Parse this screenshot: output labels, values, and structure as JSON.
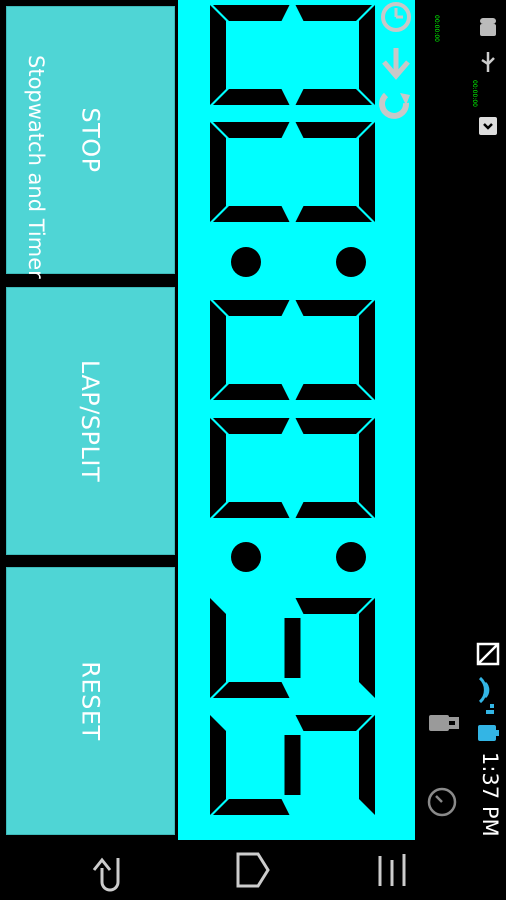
{
  "app": {
    "title": "Stopwatch and Timer"
  },
  "buttons": {
    "stop": "STOP",
    "lap": "LAP/SPLIT",
    "reset": "RESET"
  },
  "display": {
    "time": "00:00:55",
    "digits": [
      "0",
      "0",
      "0",
      "0",
      "5",
      "5"
    ]
  },
  "status_bar": {
    "time": "1:37 PM",
    "mini_time_1": "00:00:00",
    "mini_time_2": "00:00:00"
  },
  "colors": {
    "display_bg": "#00ffff",
    "button_bg": "#4fd5d5",
    "segment": "#000000",
    "battery": "#33b5e5",
    "signal": "#33b5e5"
  }
}
